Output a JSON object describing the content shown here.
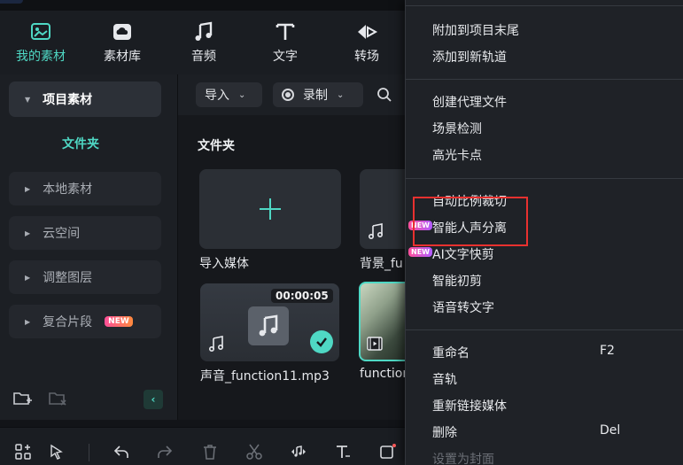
{
  "tabs": [
    {
      "label": "我的素材",
      "icon": "media-icon",
      "active": true
    },
    {
      "label": "素材库",
      "icon": "cloud-library-icon",
      "active": false
    },
    {
      "label": "音频",
      "icon": "music-note-icon",
      "active": false
    },
    {
      "label": "文字",
      "icon": "text-icon",
      "active": false
    },
    {
      "label": "转场",
      "icon": "transition-icon",
      "active": false
    }
  ],
  "sidebar": {
    "header": "项目素材",
    "folder": "文件夹",
    "items": [
      {
        "label": "本地素材"
      },
      {
        "label": "云空间"
      },
      {
        "label": "调整图层"
      },
      {
        "label": "复合片段",
        "badge": "NEW"
      }
    ]
  },
  "toolbar": {
    "import_label": "导入",
    "record_label": "录制"
  },
  "media": {
    "section_title": "文件夹",
    "cards": [
      {
        "label": "导入媒体"
      },
      {
        "label": "背景_fu"
      },
      {
        "label": "声音_function11.mp3",
        "duration": "00:00:05"
      },
      {
        "label": "function"
      }
    ]
  },
  "context_menu": {
    "items": [
      {
        "label": "附加到项目末尾"
      },
      {
        "label": "添加到新轨道"
      },
      {
        "label": "创建代理文件"
      },
      {
        "label": "场景检测"
      },
      {
        "label": "高光卡点"
      },
      {
        "label": "自动比例裁切"
      },
      {
        "label": "智能人声分离",
        "badge": "NEW"
      },
      {
        "label": "AI文字快剪",
        "badge": "NEW"
      },
      {
        "label": "智能初剪"
      },
      {
        "label": "语音转文字"
      },
      {
        "label": "重命名",
        "shortcut": "F2"
      },
      {
        "label": "音轨"
      },
      {
        "label": "重新链接媒体"
      },
      {
        "label": "删除",
        "shortcut": "Del"
      },
      {
        "label": "设置为封面",
        "disabled": true
      }
    ]
  },
  "colors": {
    "accent": "#4fd8c4",
    "highlight": "#e8312f"
  }
}
